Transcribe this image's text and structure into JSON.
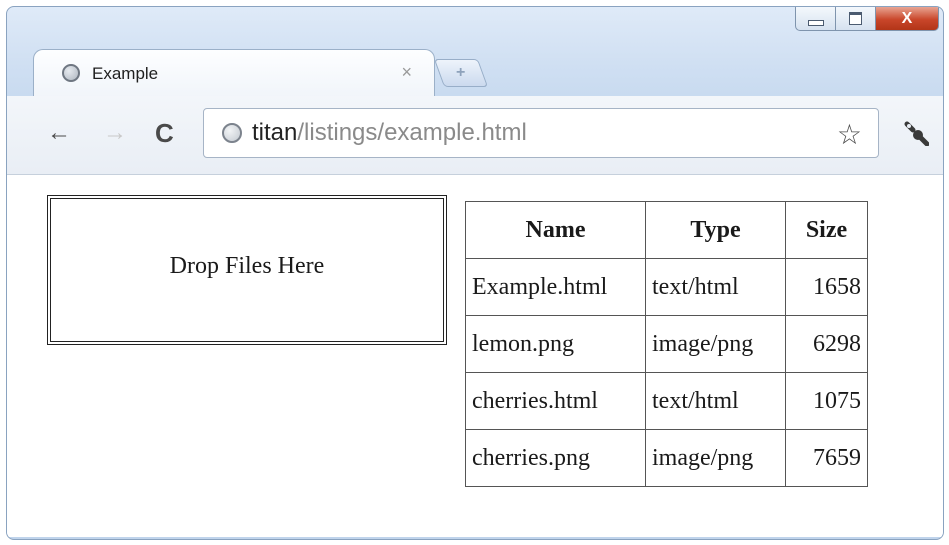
{
  "window": {
    "close_glyph": "X"
  },
  "tab": {
    "title": "Example",
    "close_glyph": "×",
    "new_tab_glyph": "+"
  },
  "toolbar": {
    "back_glyph": "←",
    "forward_glyph": "→",
    "reload_glyph": "C",
    "url_host": "titan",
    "url_path": "/listings/example.html",
    "bookmark_glyph": "☆"
  },
  "page": {
    "drop_zone_text": "Drop Files Here",
    "table": {
      "headers": [
        "Name",
        "Type",
        "Size"
      ],
      "rows": [
        [
          "Example.html",
          "text/html",
          "1658"
        ],
        [
          "lemon.png",
          "image/png",
          "6298"
        ],
        [
          "cherries.html",
          "text/html",
          "1075"
        ],
        [
          "cherries.png",
          "image/png",
          "7659"
        ]
      ]
    }
  },
  "icons": {
    "tab_favicon": "globe-icon",
    "omnibox_icon": "globe-icon",
    "bookmark": "star-icon",
    "settings": "wrench-icon"
  },
  "colors": {
    "close_button": "#c9462a",
    "frame": "#c2d6ee",
    "url_path": "#8a8a8a"
  }
}
